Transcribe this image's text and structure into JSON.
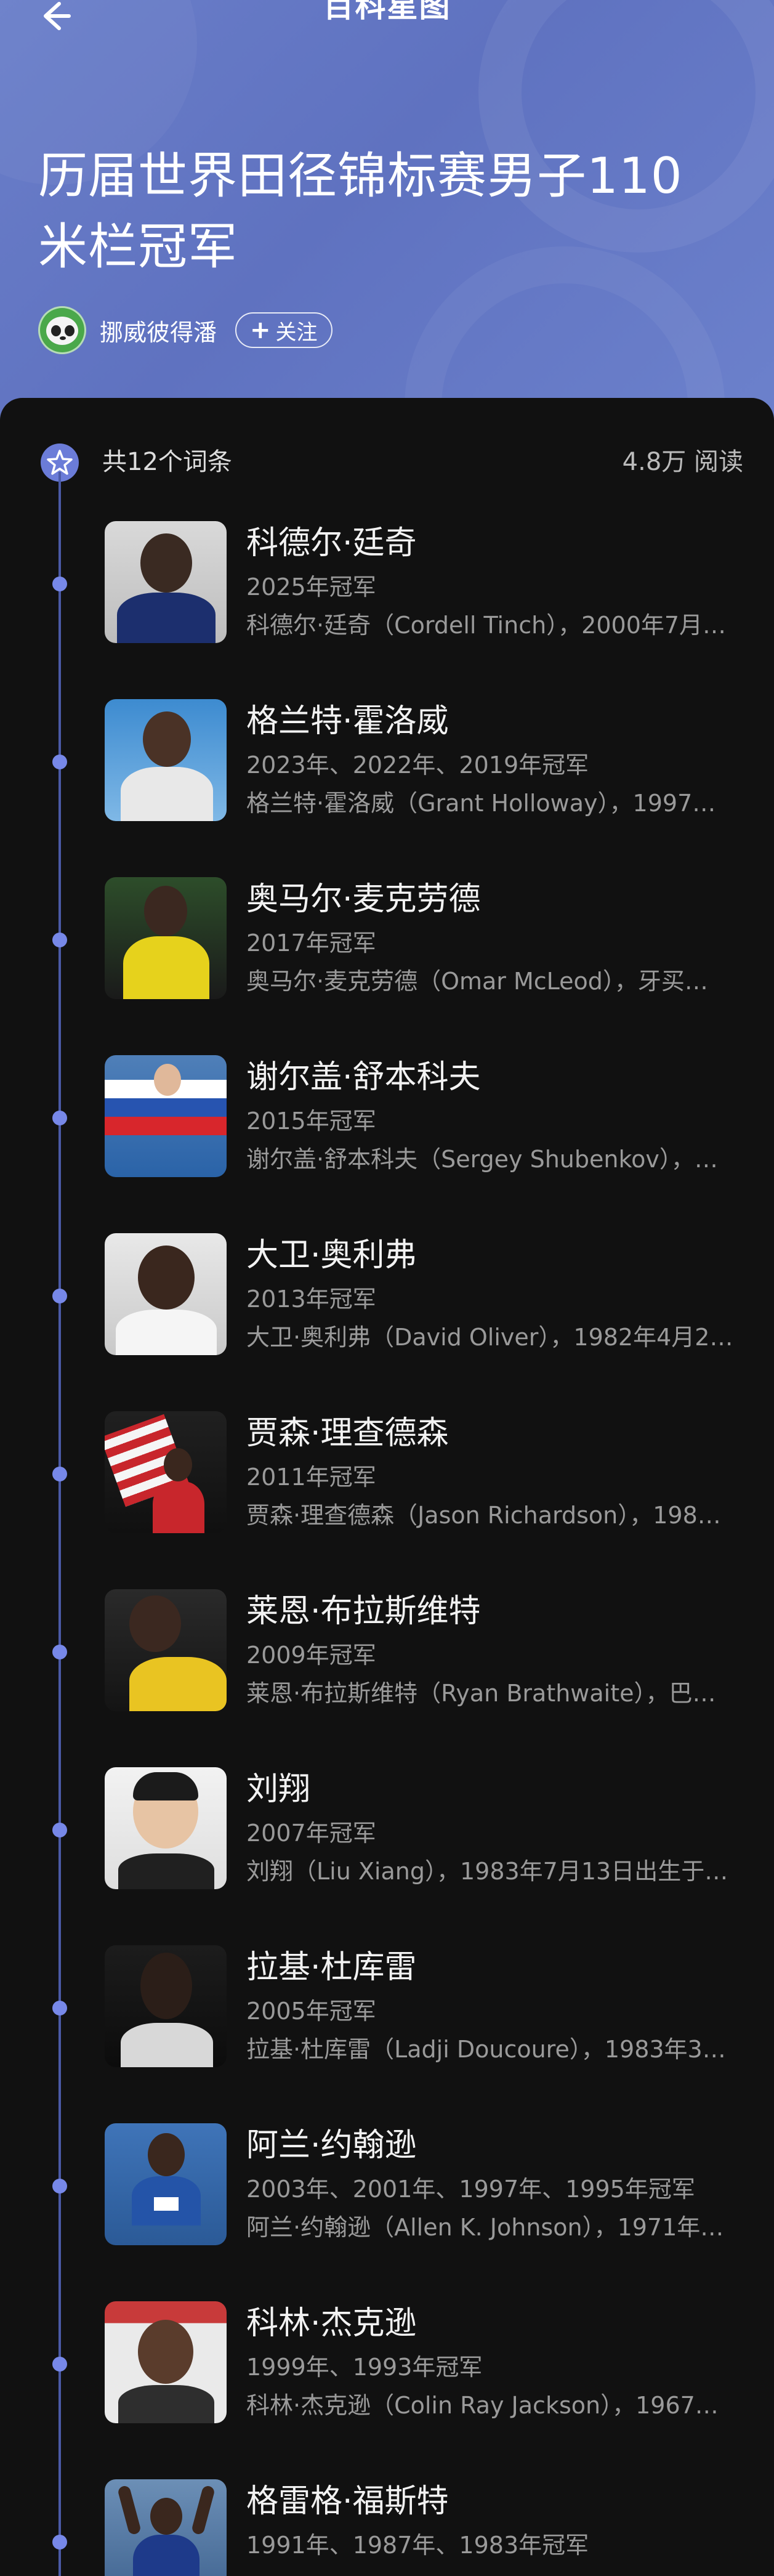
{
  "nav": {
    "title": "百科星图",
    "back_icon": "arrow-left-icon"
  },
  "page": {
    "title": "历届世界田径锦标赛男子110米栏冠军"
  },
  "author": {
    "name": "挪威彼得潘",
    "follow_label": "关注",
    "follow_icon": "plus-icon"
  },
  "summary": {
    "count_text": "共12个词条",
    "views_text": "4.8万 阅读"
  },
  "colors": {
    "header_bg": "#6577c6",
    "accent": "#6b7cd8",
    "timeline": "#4b5aa6",
    "background": "#111111"
  },
  "entries": [
    {
      "name": "科德尔·廷奇",
      "years": "2025年冠军",
      "desc": "科德尔·廷奇（Cordell Tinch），2000年7月…"
    },
    {
      "name": "格兰特·霍洛威",
      "years": "2023年、2022年、2019年冠军",
      "desc": "格兰特·霍洛威（Grant Holloway），1997…"
    },
    {
      "name": "奥马尔·麦克劳德",
      "years": "2017年冠军",
      "desc": "奥马尔·麦克劳德（Omar McLeod），牙买…"
    },
    {
      "name": "谢尔盖·舒本科夫",
      "years": "2015年冠军",
      "desc": "谢尔盖·舒本科夫（Sergey Shubenkov），…"
    },
    {
      "name": "大卫·奥利弗",
      "years": "2013年冠军",
      "desc": "大卫·奥利弗（David Oliver），1982年4月2…"
    },
    {
      "name": "贾森·理查德森",
      "years": "2011年冠军",
      "desc": "贾森·理查德森（Jason Richardson），198…"
    },
    {
      "name": "莱恩·布拉斯维特",
      "years": "2009年冠军",
      "desc": "莱恩·布拉斯维特（Ryan Brathwaite），巴…"
    },
    {
      "name": "刘翔",
      "years": "2007年冠军",
      "desc": "刘翔（Liu Xiang），1983年7月13日出生于…"
    },
    {
      "name": "拉基·杜库雷",
      "years": "2005年冠军",
      "desc": "拉基·杜库雷（Ladji Doucoure），1983年3…"
    },
    {
      "name": "阿兰·约翰逊",
      "years": "2003年、2001年、1997年、1995年冠军",
      "desc": "阿兰·约翰逊（Allen K. Johnson），1971年…"
    },
    {
      "name": "科林·杰克逊",
      "years": "1999年、1993年冠军",
      "desc": "科林·杰克逊（Colin Ray Jackson），1967…"
    },
    {
      "name": "格雷格·福斯特",
      "years": "1991年、1987年、1983年冠军",
      "desc": ""
    }
  ]
}
